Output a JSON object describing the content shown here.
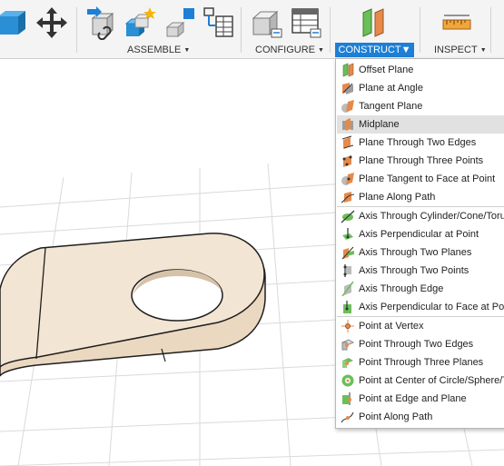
{
  "toolbar": {
    "groups": [
      {
        "label": "ASSEMBLE"
      },
      {
        "label": "CONFIGURE"
      },
      {
        "label": "CONSTRUCT"
      },
      {
        "label": "INSPECT"
      }
    ],
    "caret": "▼"
  },
  "menu": {
    "items": [
      {
        "label": "Offset Plane",
        "icon": "offset-plane-icon"
      },
      {
        "label": "Plane at Angle",
        "icon": "plane-at-angle-icon"
      },
      {
        "label": "Tangent Plane",
        "icon": "tangent-plane-icon"
      },
      {
        "label": "Midplane",
        "icon": "midplane-icon"
      },
      {
        "label": "Plane Through Two Edges",
        "icon": "plane-two-edges-icon"
      },
      {
        "label": "Plane Through Three Points",
        "icon": "plane-three-points-icon"
      },
      {
        "label": "Plane Tangent to Face at Point",
        "icon": "plane-tangent-face-icon"
      },
      {
        "label": "Plane Along Path",
        "icon": "plane-along-path-icon"
      },
      {
        "label": "Axis Through Cylinder/Cone/Torus",
        "icon": "axis-cylinder-icon"
      },
      {
        "label": "Axis Perpendicular at Point",
        "icon": "axis-perpendicular-point-icon"
      },
      {
        "label": "Axis Through Two Planes",
        "icon": "axis-two-planes-icon"
      },
      {
        "label": "Axis Through Two Points",
        "icon": "axis-two-points-icon"
      },
      {
        "label": "Axis Through Edge",
        "icon": "axis-edge-icon"
      },
      {
        "label": "Axis Perpendicular to Face at Point",
        "icon": "axis-perpendicular-face-icon"
      },
      {
        "label": "Point at Vertex",
        "icon": "point-vertex-icon"
      },
      {
        "label": "Point Through Two Edges",
        "icon": "point-two-edges-icon"
      },
      {
        "label": "Point Through Three Planes",
        "icon": "point-three-planes-icon"
      },
      {
        "label": "Point at Center of Circle/Sphere/Torus",
        "icon": "point-center-icon"
      },
      {
        "label": "Point at Edge and Plane",
        "icon": "point-edge-plane-icon"
      },
      {
        "label": "Point Along Path",
        "icon": "point-along-path-icon"
      }
    ],
    "highlighted": "Midplane"
  },
  "colors": {
    "accent": "#1d7fd6",
    "part_fill": "#f3e5d3",
    "grid": "#d9d9d9",
    "plane_green": "#6bbf59",
    "plane_orange": "#e58a4a"
  }
}
